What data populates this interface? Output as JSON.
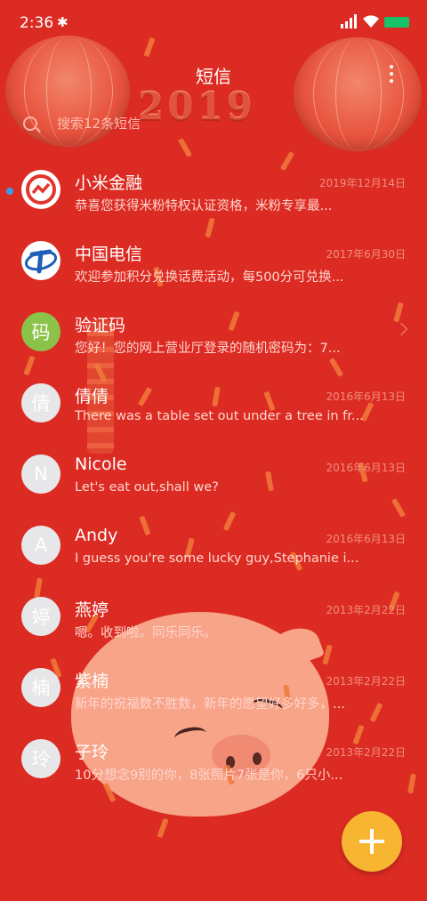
{
  "status_bar": {
    "time": "2:36",
    "bluetooth_icon": "bluetooth-icon",
    "signal_icon": "signal-icon",
    "wifi_icon": "wifi-icon",
    "battery_icon": "battery-icon"
  },
  "header": {
    "title": "短信",
    "menu_icon": "more-vertical-icon"
  },
  "background": {
    "year_text": "2019"
  },
  "search": {
    "placeholder": "搜索12条短信",
    "icon": "search-icon"
  },
  "colors": {
    "background": "#dc2b22",
    "fab": "#f7b531",
    "unread_dot": "#3a9cf0",
    "avatar_default": "#e7e7ea",
    "avatar_code": "#8bc34a"
  },
  "messages": [
    {
      "name": "小米金融",
      "date": "2019年12月14日",
      "preview": "恭喜您获得米粉特权认证资格，米粉专享最...",
      "avatar_icon": "mi-finance-logo-icon",
      "unread": true
    },
    {
      "name": "中国电信",
      "date": "2017年6月30日",
      "preview": "欢迎参加积分兑换话费活动，每500分可兑换...",
      "avatar_icon": "china-telecom-logo-icon",
      "unread": false
    },
    {
      "name": "验证码",
      "date": "",
      "preview": "您好！您的网上营业厅登录的随机密码为：7...",
      "avatar_text": "码",
      "has_chevron": true,
      "unread": false
    },
    {
      "name": "倩倩",
      "date": "2016年6月13日",
      "preview": "There was a table set out under a tree in fr...",
      "avatar_text": "倩",
      "unread": false
    },
    {
      "name": "Nicole",
      "date": "2016年6月13日",
      "preview": "Let's eat out,shall we?",
      "avatar_text": "N",
      "unread": false
    },
    {
      "name": "Andy",
      "date": "2016年6月13日",
      "preview": "I guess you're some lucky guy,Stephanie i...",
      "avatar_text": "A",
      "unread": false
    },
    {
      "name": "燕婷",
      "date": "2013年2月22日",
      "preview": "嗯。收到啦。同乐同乐。",
      "avatar_text": "婷",
      "unread": false
    },
    {
      "name": "紫楠",
      "date": "2013年2月22日",
      "preview": "新年的祝福数不胜数，新年的愿望好多好多，...",
      "avatar_text": "楠",
      "unread": false
    },
    {
      "name": "子玲",
      "date": "2013年2月22日",
      "preview": "10分想念9别的你，8张照片7张是你，6只小...",
      "avatar_text": "玲",
      "unread": false
    }
  ],
  "fab": {
    "icon": "plus-icon"
  }
}
